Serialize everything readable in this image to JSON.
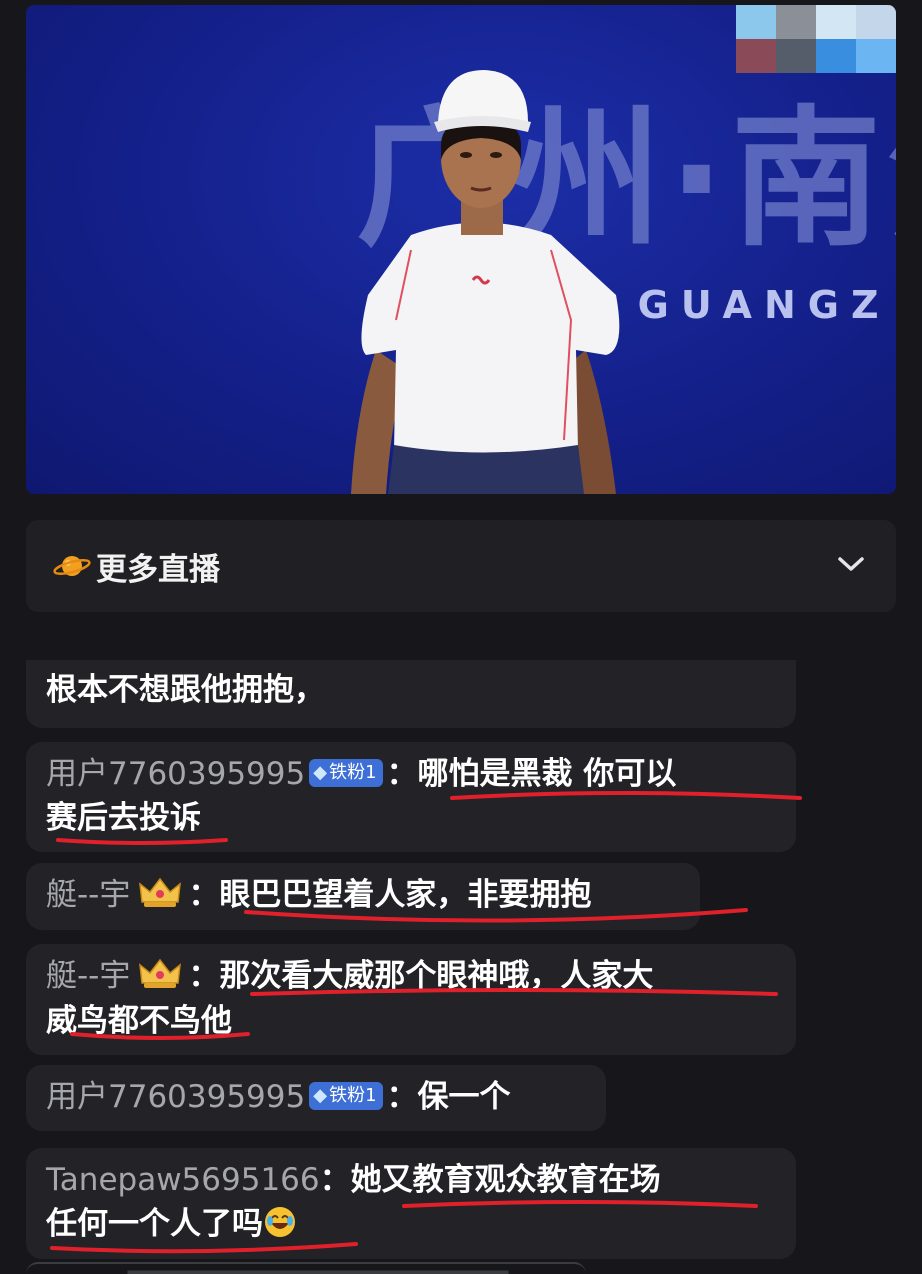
{
  "video": {
    "banner_big": "广州·南沙",
    "banner_small": "· GUANGZ"
  },
  "more_live": {
    "label": "更多直播",
    "icon": "planet-icon",
    "toggle_icon": "chevron-down-icon"
  },
  "chat": {
    "messages": [
      {
        "user": "",
        "text": "根本不想跟他拥抱，",
        "badge": ""
      },
      {
        "user": "用户7760395995",
        "badge": "铁粉1",
        "colon": "：",
        "text_line1": "哪怕是黑裁 你可以",
        "text_line2": "赛后去投诉"
      },
      {
        "user": "艇--宇",
        "badge_icon": "crown-icon",
        "colon": "：",
        "text": "眼巴巴望着人家，非要拥抱"
      },
      {
        "user": "艇--宇",
        "badge_icon": "crown-icon",
        "colon": "：",
        "text_line1": "那次看大威那个眼神哦，人家大",
        "text_line2": "威鸟都不鸟他"
      },
      {
        "user": "用户7760395995",
        "badge": "铁粉1",
        "colon": "：",
        "text": "保一个"
      },
      {
        "user": "Tanepaw5695166",
        "colon": "：",
        "text_line1": "她又教育观众教育在场",
        "text_line2": "任何一个人了吗",
        "emoji": "laugh-icon"
      }
    ]
  },
  "colors": {
    "background": "#17171b",
    "bubble": "#222227",
    "username": "#a6a6ad",
    "badge": "#3d6fd6",
    "annotation_red": "#e0202a"
  }
}
